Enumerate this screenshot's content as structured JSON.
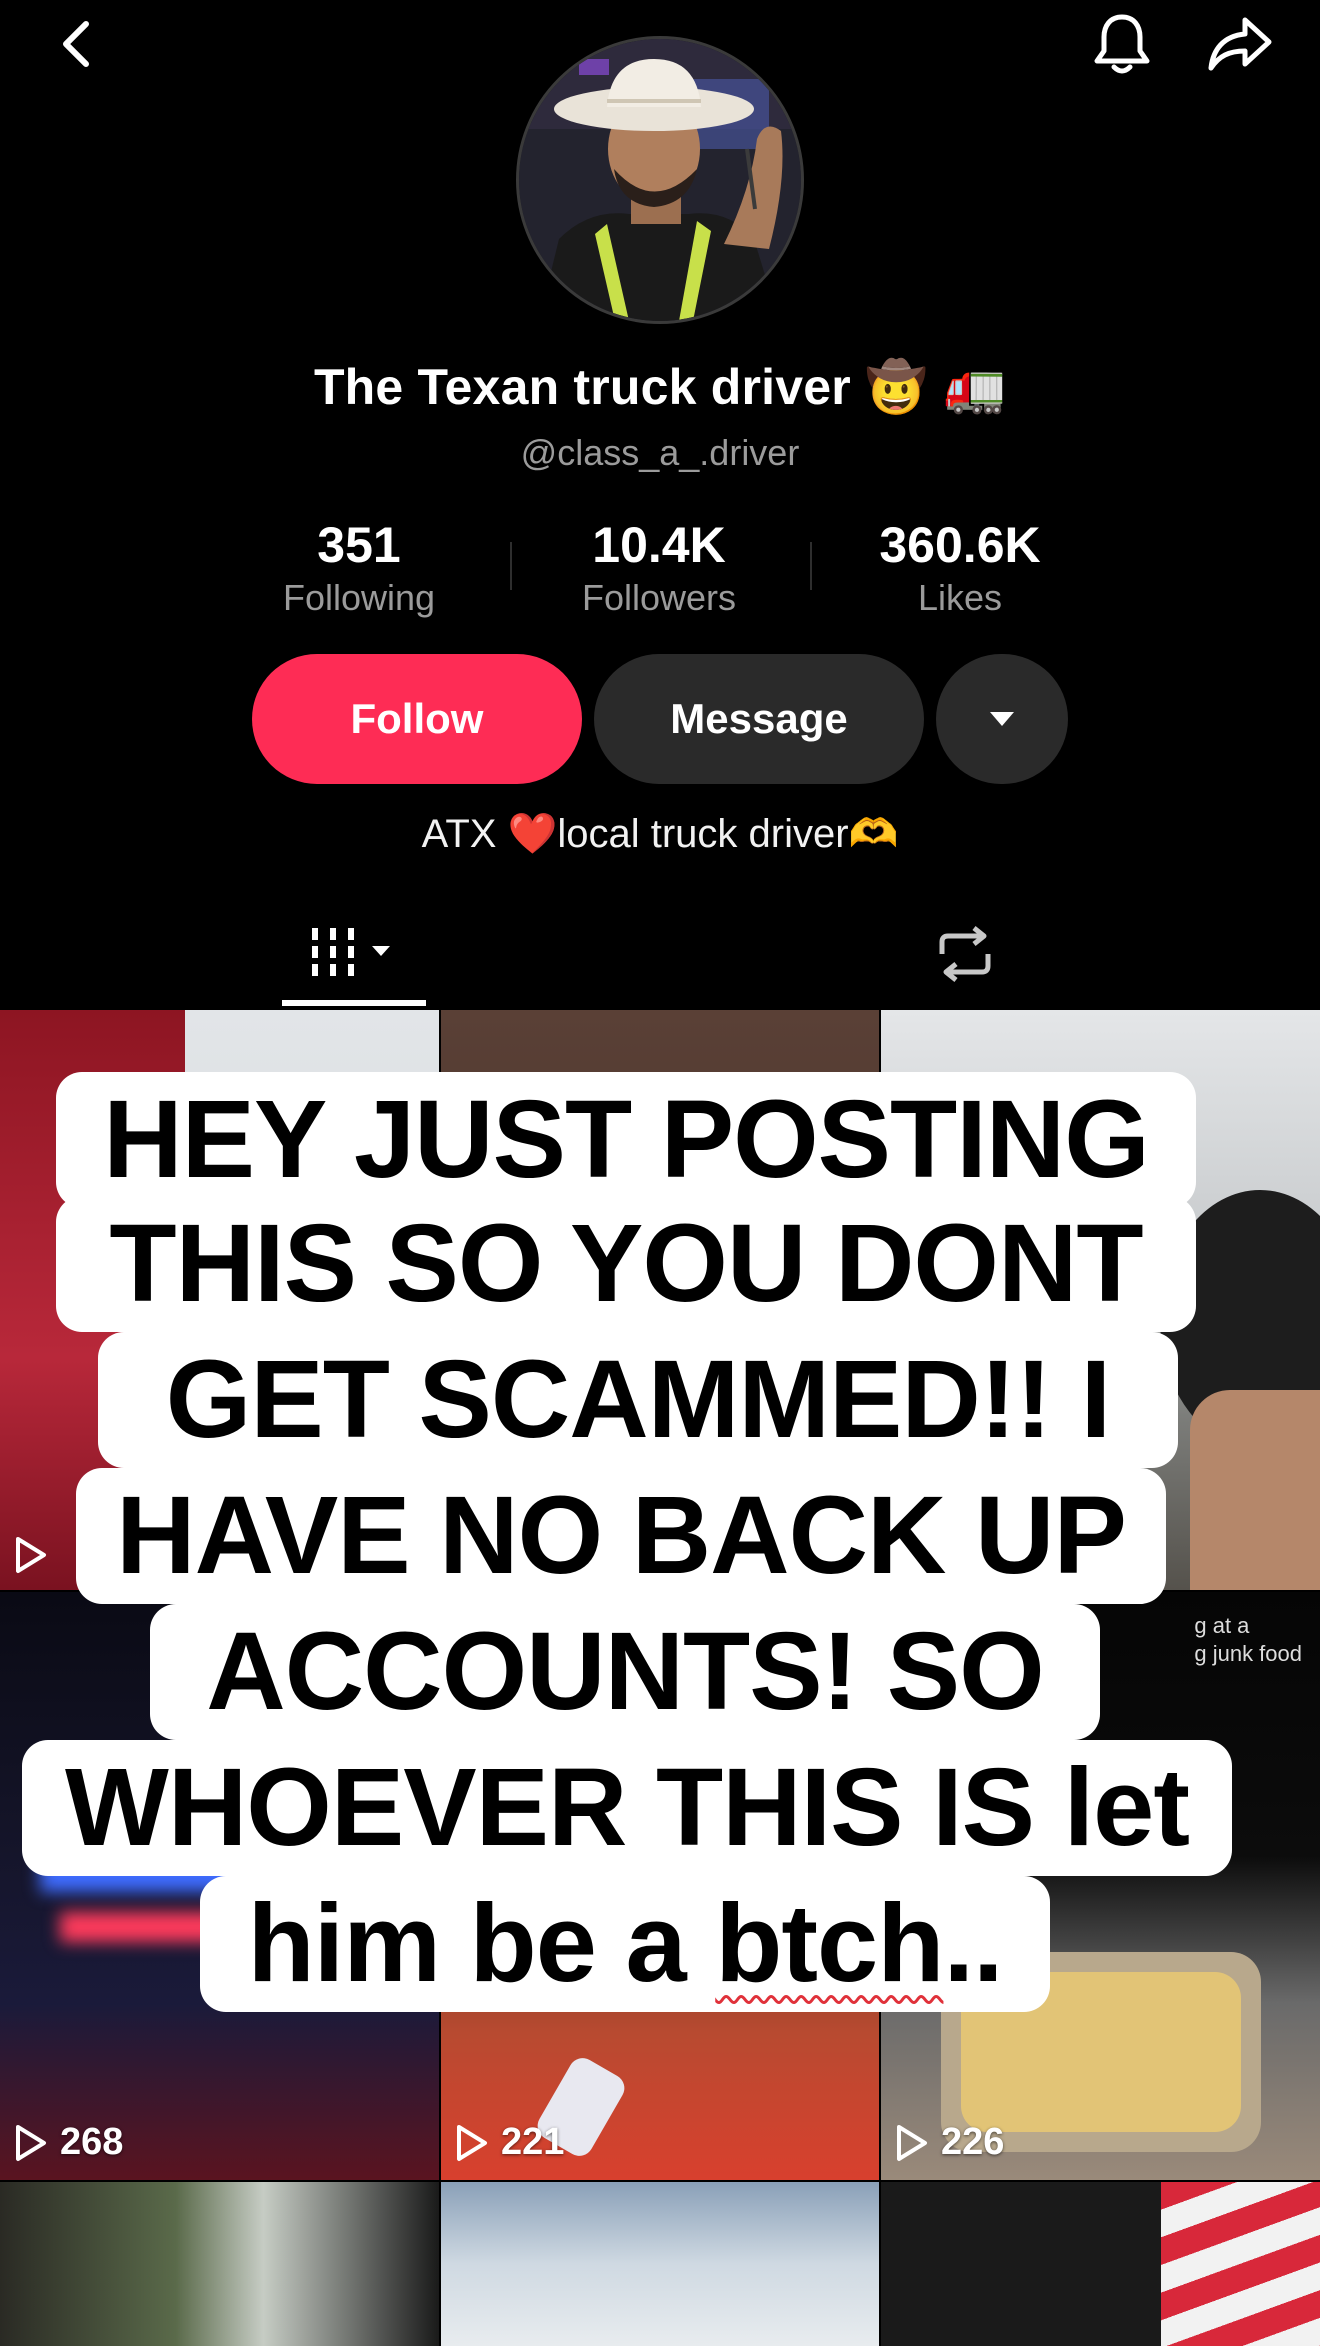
{
  "profile": {
    "display_name": "The Texan truck driver",
    "display_name_emojis": "🤠 🚛",
    "username": "@class_a_.driver",
    "bio": "ATX ❤️local truck driver🫶"
  },
  "stats": {
    "following": {
      "value": "351",
      "label": "Following"
    },
    "followers": {
      "value": "10.4K",
      "label": "Followers"
    },
    "likes": {
      "value": "360.6K",
      "label": "Likes"
    }
  },
  "actions": {
    "follow_label": "Follow",
    "message_label": "Message"
  },
  "icons": {
    "back": "chevron-left-icon",
    "notifications": "bell-icon",
    "share": "share-arrow-icon",
    "more": "caret-down-icon",
    "videos_tab": "grid-bars-icon",
    "reposts_tab": "repost-icon",
    "play": "play-outline-icon"
  },
  "colors": {
    "follow": "#fe2c55",
    "secondary_button": "#2a2a2a",
    "background": "#000000"
  },
  "grid": {
    "tiles": [
      {
        "views": ""
      },
      {
        "views": ""
      },
      {
        "views": ""
      },
      {
        "views": "268"
      },
      {
        "views": "221"
      },
      {
        "views": "226"
      },
      {
        "views": ""
      },
      {
        "views": ""
      },
      {
        "views": ""
      }
    ],
    "partial_caption_line1": "g at a",
    "partial_caption_line2": "g junk food"
  },
  "overlay": {
    "lines": [
      "HEY JUST POSTING",
      "THIS SO YOU DONT",
      "GET SCAMMED!! I",
      "HAVE NO BACK UP",
      "ACCOUNTS! SO",
      "WHOEVER THIS IS let"
    ],
    "last_line_pre": "him be a ",
    "last_line_flagged": "btch",
    "last_line_post": ".."
  }
}
